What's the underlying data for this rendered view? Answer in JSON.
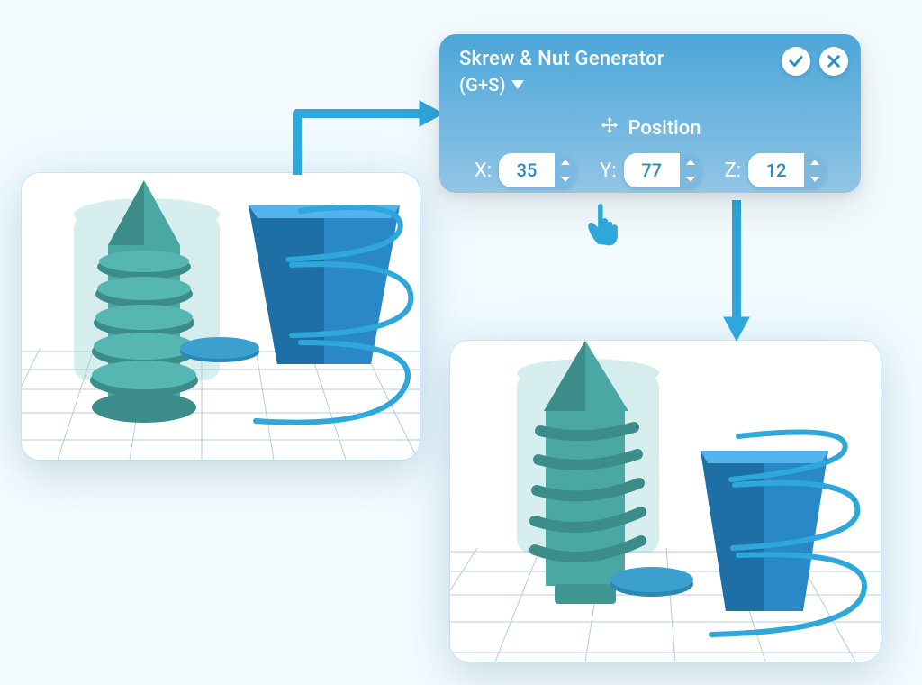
{
  "panel": {
    "title": "Skrew & Nut Generator",
    "subtitle": "(G+S)",
    "position_label": "Position",
    "x_label": "X:",
    "y_label": "Y:",
    "z_label": "Z:",
    "x_value": "35",
    "y_value": "77",
    "z_value": "12"
  }
}
